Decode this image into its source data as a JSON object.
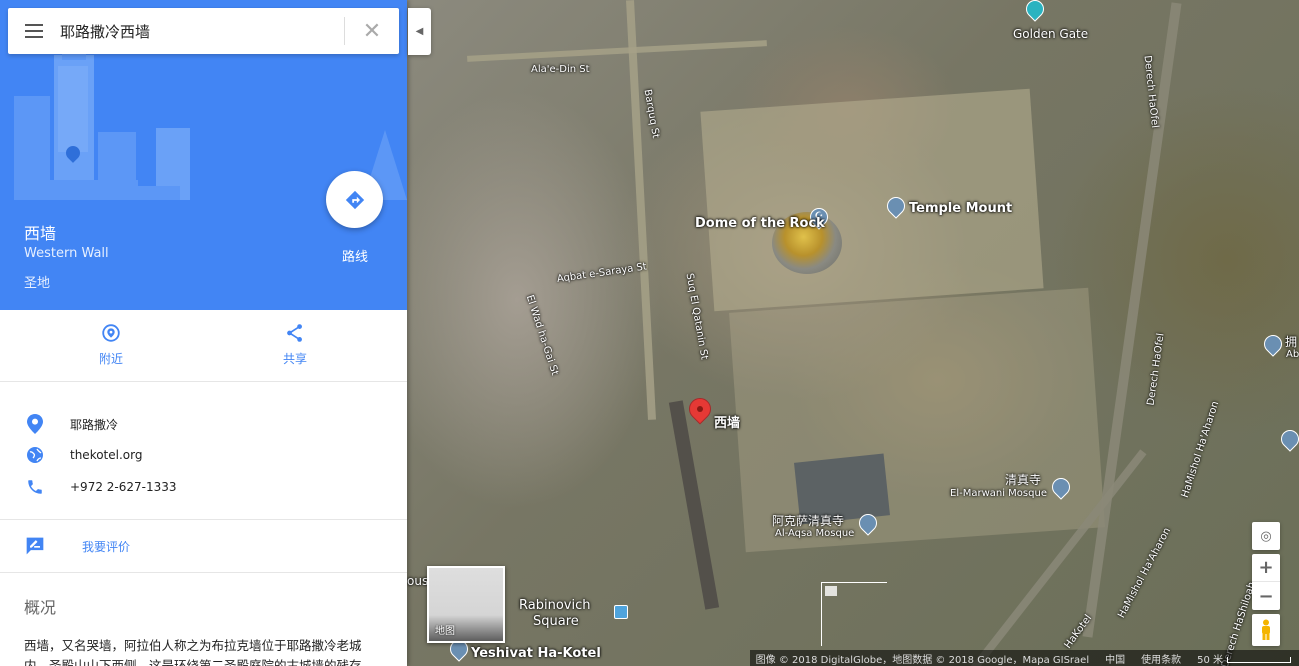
{
  "search": {
    "query": "耶路撒冷西墙"
  },
  "place": {
    "title": "西墙",
    "subtitle": "Western Wall",
    "category": "圣地",
    "directions_label": "路线"
  },
  "actions": [
    {
      "label": "附近",
      "icon": "nearby-icon"
    },
    {
      "label": "共享",
      "icon": "share-icon"
    }
  ],
  "info": {
    "address": "耶路撒冷",
    "website": "thekotel.org",
    "phone": "+972 2-627-1333"
  },
  "review_label": "我要评价",
  "overview": {
    "title": "概况",
    "text": "西墙，又名哭墙，阿拉伯人称之为布拉克墙位于耶路撒冷老城内，圣殿山山下西侧，这是环绕第二圣殿庭院的古城墙的残存"
  },
  "map": {
    "labels": {
      "golden_gate": "Golden Gate",
      "dome_of_rock": "Dome of the Rock",
      "temple_mount": "Temple Mount",
      "western_wall_pin": "西墙",
      "marwani_cn": "清真寺",
      "marwani_en": "El-Marwani Mosque",
      "aqsa_cn": "阿克萨清真寺",
      "aqsa_en": "Al-Aqsa Mosque",
      "rabinovich_1": "Rabinovich",
      "rabinovich_2": "Square",
      "yeshivat": "Yeshivat Ha-Kotel",
      "edge_cn": "拥",
      "edge_en": "Ab",
      "house_partial": "ouse"
    },
    "streets": {
      "alaedin": "Ala'e-Din St",
      "barquq": "Barquq St",
      "aqbat": "Aqbat e-Saraya St",
      "qatanin": "Suq El Qatanin St",
      "wadi": "El Wad ha-Gai St",
      "haofel_top": "Derech HaOfel",
      "haofel_mid": "Derech HaOfel",
      "hamishol_1": "HaMishol Ha'Aharon",
      "hamishol_2": "HaMishol Ha'Aharon",
      "hashiloah": "Derech HaShiloah",
      "hakotel": "HaKotel"
    },
    "minimap_label": "地图",
    "attribution": {
      "imagery": "图像 © 2018 DigitalGlobe，地图数据 © 2018 Google，Mapa GISrael",
      "region": "中国",
      "terms": "使用条款",
      "scale": "50 米"
    }
  }
}
